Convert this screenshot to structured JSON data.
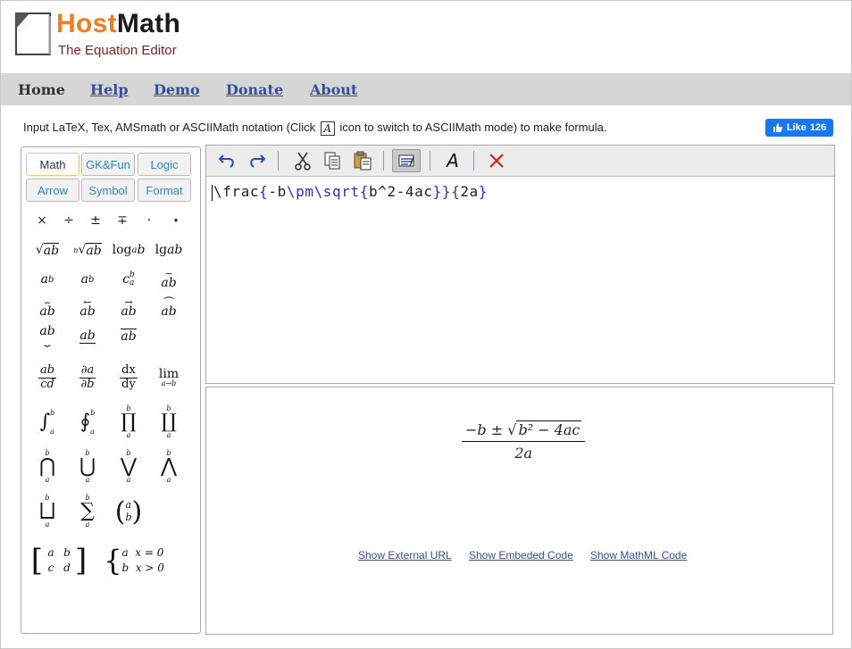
{
  "header": {
    "brand_host": "Host",
    "brand_math": "Math",
    "tagline": "The Equation Editor"
  },
  "nav": {
    "home": "Home",
    "help": "Help",
    "demo": "Demo",
    "donate": "Donate",
    "about": "About"
  },
  "instruction": {
    "prefix": "Input LaTeX, Tex, AMSmath or ASCIIMath notation (Click",
    "icon": "A",
    "suffix": "icon to switch to ASCIIMath mode) to make formula."
  },
  "like": {
    "label": "Like",
    "count": "126"
  },
  "tabs": [
    "Math",
    "GK&Fun",
    "Logic",
    "Arrow",
    "Symbol",
    "Format"
  ],
  "operators": [
    "×",
    "÷",
    "±",
    "∓",
    "·",
    "⋆"
  ],
  "editor": {
    "code_cmd1": "\\frac",
    "code_b1": "{",
    "code_t1": "-b",
    "code_cmd2": "\\pm\\sqrt",
    "code_b2": "{",
    "code_t2": "b^2-4ac",
    "code_b3": "}}{",
    "code_t3": "2a",
    "code_b4": "}"
  },
  "toolbar_icons": [
    "undo-icon",
    "redo-icon",
    "cut-icon",
    "copy-icon",
    "paste-icon",
    "preview-icon",
    "ascii-font-icon",
    "clear-icon"
  ],
  "preview": {
    "numerator": "−b ± ",
    "radicand": "b² − 4ac",
    "denominator": "2a",
    "link_url": "Show External URL",
    "link_embed": "Show Embeded Code",
    "link_mathml": "Show MathML Code"
  }
}
